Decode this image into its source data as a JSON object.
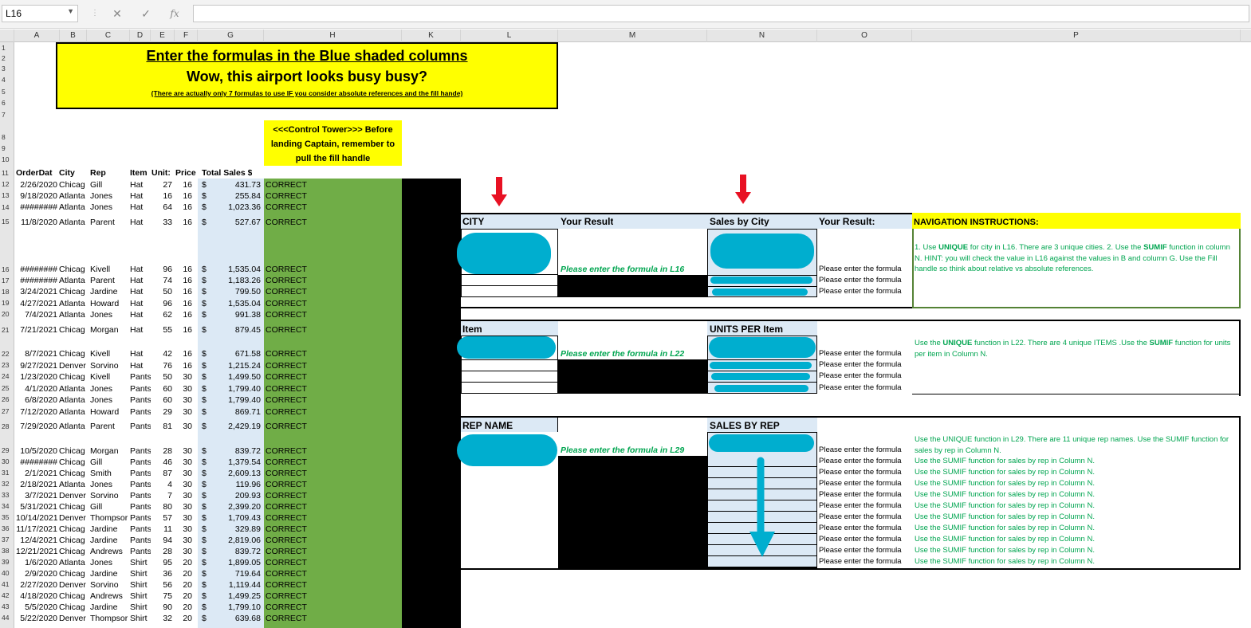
{
  "formula_bar": {
    "name_box": "L16",
    "cancel": "✕",
    "enter": "✓",
    "fx": "fx",
    "formula": ""
  },
  "columns": [
    "A",
    "B",
    "C",
    "D",
    "E",
    "F",
    "G",
    "H",
    "K",
    "L",
    "M",
    "N",
    "O",
    "P"
  ],
  "rows": [
    "1",
    "2",
    "3",
    "4",
    "5",
    "6",
    "7",
    "8",
    "9",
    "10",
    "11",
    "12",
    "13",
    "14",
    "15",
    "16",
    "17",
    "18",
    "19",
    "20",
    "21",
    "22",
    "23",
    "24",
    "25",
    "26",
    "27",
    "28",
    "29",
    "30",
    "31",
    "32",
    "33",
    "34",
    "35",
    "36",
    "37",
    "38",
    "39",
    "40",
    "41",
    "42",
    "43",
    "44"
  ],
  "banner": {
    "line1": "Enter the formulas in the Blue shaded columns",
    "line2": "Wow, this airport looks busy busy?",
    "line3": "(There are actually only 7 formulas to use IF you consider absolute references and the fill hande)"
  },
  "control_tower": {
    "line1": "<<<Control Tower>>> Before",
    "line2": "landing Captain, remember to",
    "line3": "pull the fill handle"
  },
  "table_headers": {
    "orderdate": "OrderDat",
    "city": "City",
    "rep": "Rep",
    "item": "Item",
    "units": "Unit:",
    "price": "Price",
    "total": "Total Sales $"
  },
  "data_rows": [
    {
      "d": "2/26/2020",
      "c": "Chicag",
      "r": "Gill",
      "i": "Hat",
      "u": "27",
      "p": "16",
      "t": "431.73",
      "s": "CORRECT"
    },
    {
      "d": "9/18/2020",
      "c": "Atlanta",
      "r": "Jones",
      "i": "Hat",
      "u": "16",
      "p": "16",
      "t": "255.84",
      "s": "CORRECT"
    },
    {
      "d": "########",
      "c": "Atlanta",
      "r": "Jones",
      "i": "Hat",
      "u": "64",
      "p": "16",
      "t": "1,023.36",
      "s": "CORRECT"
    },
    {
      "d": "11/8/2020",
      "c": "Atlanta",
      "r": "Parent",
      "i": "Hat",
      "u": "33",
      "p": "16",
      "t": "527.67",
      "s": "CORRECT"
    },
    {
      "d": "########",
      "c": "Chicag",
      "r": "Kivell",
      "i": "Hat",
      "u": "96",
      "p": "16",
      "t": "1,535.04",
      "s": "CORRECT"
    },
    {
      "d": "########",
      "c": "Atlanta",
      "r": "Parent",
      "i": "Hat",
      "u": "74",
      "p": "16",
      "t": "1,183.26",
      "s": "CORRECT"
    },
    {
      "d": "3/24/2021",
      "c": "Chicag",
      "r": "Jardine",
      "i": "Hat",
      "u": "50",
      "p": "16",
      "t": "799.50",
      "s": "CORRECT"
    },
    {
      "d": "4/27/2021",
      "c": "Atlanta",
      "r": "Howard",
      "i": "Hat",
      "u": "96",
      "p": "16",
      "t": "1,535.04",
      "s": "CORRECT"
    },
    {
      "d": "7/4/2021",
      "c": "Atlanta",
      "r": "Jones",
      "i": "Hat",
      "u": "62",
      "p": "16",
      "t": "991.38",
      "s": "CORRECT"
    },
    {
      "d": "7/21/2021",
      "c": "Chicag",
      "r": "Morgan",
      "i": "Hat",
      "u": "55",
      "p": "16",
      "t": "879.45",
      "s": "CORRECT"
    },
    {
      "d": "8/7/2021",
      "c": "Chicag",
      "r": "Kivell",
      "i": "Hat",
      "u": "42",
      "p": "16",
      "t": "671.58",
      "s": "CORRECT"
    },
    {
      "d": "9/27/2021",
      "c": "Denver",
      "r": "Sorvino",
      "i": "Hat",
      "u": "76",
      "p": "16",
      "t": "1,215.24",
      "s": "CORRECT"
    },
    {
      "d": "1/23/2020",
      "c": "Chicag",
      "r": "Kivell",
      "i": "Pants",
      "u": "50",
      "p": "30",
      "t": "1,499.50",
      "s": "CORRECT"
    },
    {
      "d": "4/1/2020",
      "c": "Atlanta",
      "r": "Jones",
      "i": "Pants",
      "u": "60",
      "p": "30",
      "t": "1,799.40",
      "s": "CORRECT"
    },
    {
      "d": "6/8/2020",
      "c": "Atlanta",
      "r": "Jones",
      "i": "Pants",
      "u": "60",
      "p": "30",
      "t": "1,799.40",
      "s": "CORRECT"
    },
    {
      "d": "7/12/2020",
      "c": "Atlanta",
      "r": "Howard",
      "i": "Pants",
      "u": "29",
      "p": "30",
      "t": "869.71",
      "s": "CORRECT"
    },
    {
      "d": "7/29/2020",
      "c": "Atlanta",
      "r": "Parent",
      "i": "Pants",
      "u": "81",
      "p": "30",
      "t": "2,429.19",
      "s": "CORRECT"
    },
    {
      "d": "10/5/2020",
      "c": "Chicag",
      "r": "Morgan",
      "i": "Pants",
      "u": "28",
      "p": "30",
      "t": "839.72",
      "s": "CORRECT"
    },
    {
      "d": "########",
      "c": "Chicag",
      "r": "Gill",
      "i": "Pants",
      "u": "46",
      "p": "30",
      "t": "1,379.54",
      "s": "CORRECT"
    },
    {
      "d": "2/1/2021",
      "c": "Chicag",
      "r": "Smith",
      "i": "Pants",
      "u": "87",
      "p": "30",
      "t": "2,609.13",
      "s": "CORRECT"
    },
    {
      "d": "2/18/2021",
      "c": "Atlanta",
      "r": "Jones",
      "i": "Pants",
      "u": "4",
      "p": "30",
      "t": "119.96",
      "s": "CORRECT"
    },
    {
      "d": "3/7/2021",
      "c": "Denver",
      "r": "Sorvino",
      "i": "Pants",
      "u": "7",
      "p": "30",
      "t": "209.93",
      "s": "CORRECT"
    },
    {
      "d": "5/31/2021",
      "c": "Chicag",
      "r": "Gill",
      "i": "Pants",
      "u": "80",
      "p": "30",
      "t": "2,399.20",
      "s": "CORRECT"
    },
    {
      "d": "10/14/2021",
      "c": "Denver",
      "r": "Thompsor",
      "i": "Pants",
      "u": "57",
      "p": "30",
      "t": "1,709.43",
      "s": "CORRECT"
    },
    {
      "d": "11/17/2021",
      "c": "Chicag",
      "r": "Jardine",
      "i": "Pants",
      "u": "11",
      "p": "30",
      "t": "329.89",
      "s": "CORRECT"
    },
    {
      "d": "12/4/2021",
      "c": "Chicag",
      "r": "Jardine",
      "i": "Pants",
      "u": "94",
      "p": "30",
      "t": "2,819.06",
      "s": "CORRECT"
    },
    {
      "d": "12/21/2021",
      "c": "Chicag",
      "r": "Andrews",
      "i": "Pants",
      "u": "28",
      "p": "30",
      "t": "839.72",
      "s": "CORRECT"
    },
    {
      "d": "1/6/2020",
      "c": "Atlanta",
      "r": "Jones",
      "i": "Shirt",
      "u": "95",
      "p": "20",
      "t": "1,899.05",
      "s": "CORRECT"
    },
    {
      "d": "2/9/2020",
      "c": "Chicag",
      "r": "Jardine",
      "i": "Shirt",
      "u": "36",
      "p": "20",
      "t": "719.64",
      "s": "CORRECT"
    },
    {
      "d": "2/27/2020",
      "c": "Denver",
      "r": "Sorvino",
      "i": "Shirt",
      "u": "56",
      "p": "20",
      "t": "1,119.44",
      "s": "CORRECT"
    },
    {
      "d": "4/18/2020",
      "c": "Chicag",
      "r": "Andrews",
      "i": "Shirt",
      "u": "75",
      "p": "20",
      "t": "1,499.25",
      "s": "CORRECT"
    },
    {
      "d": "5/5/2020",
      "c": "Chicag",
      "r": "Jardine",
      "i": "Shirt",
      "u": "90",
      "p": "20",
      "t": "1,799.10",
      "s": "CORRECT"
    },
    {
      "d": "5/22/2020",
      "c": "Denver",
      "r": "Thompsor",
      "i": "Shirt",
      "u": "32",
      "p": "20",
      "t": "639.68",
      "s": "CORRECT"
    }
  ],
  "dollar": "$",
  "city_section": {
    "h1": "CITY",
    "h2": "Your Result",
    "h3": "Sales by City",
    "h4": "Your Result:",
    "h5": "NAVIGATION INSTRUCTIONS:",
    "placeholder": "Please enter the formula in L16",
    "side": [
      "Please enter the formula",
      "Please enter the formula",
      "Please enter the formula"
    ],
    "nav_parts": [
      "1. Use ",
      "UNIQUE",
      " for city in L16. There are 3 unique cities. 2. Use the ",
      "SUMIF",
      " function in column N. HINT: you will check the value in L16 against the values in B and column G. Use the Fill handle so think about relative vs absolute references."
    ]
  },
  "item_section": {
    "h1": "Item",
    "h3": "UNITS PER Item",
    "placeholder": "Please enter the formula in L22",
    "side": [
      "Please enter the formula",
      "Please enter the formula",
      "Please enter the formula",
      "Please enter the formula"
    ],
    "nav_parts": [
      "Use the ",
      "UNIQUE",
      " function in  L22. There are 4 unique ITEMS .Use the ",
      "SUMIF",
      " function for units per item in Column N."
    ]
  },
  "rep_section": {
    "h1": "REP NAME",
    "h3": "SALES BY REP",
    "placeholder": "Please enter the formula in L29",
    "side": [
      "Please enter the formula",
      "Please enter the formula",
      "Please enter the formula",
      "Please enter the formula",
      "Please enter the formula",
      "Please enter the formula",
      "Please enter the formula",
      "Please enter the formula",
      "Please enter the formula",
      "Please enter the formula",
      "Please enter the formula"
    ],
    "nav_first": "Use the UNIQUE function in L29. There are 11 unique rep names. Use the SUMIF function for sales by rep in Column N.",
    "nav_rest": "Use the SUMIF function for sales by rep in Column N."
  },
  "colors": {
    "banner": "#ffff00",
    "green_fill": "#70ad47",
    "black": "#000000",
    "light_blue": "#dce9f5",
    "scribble": "#00aecf",
    "arrow": "#e81123",
    "nav_text": "#00a550"
  }
}
